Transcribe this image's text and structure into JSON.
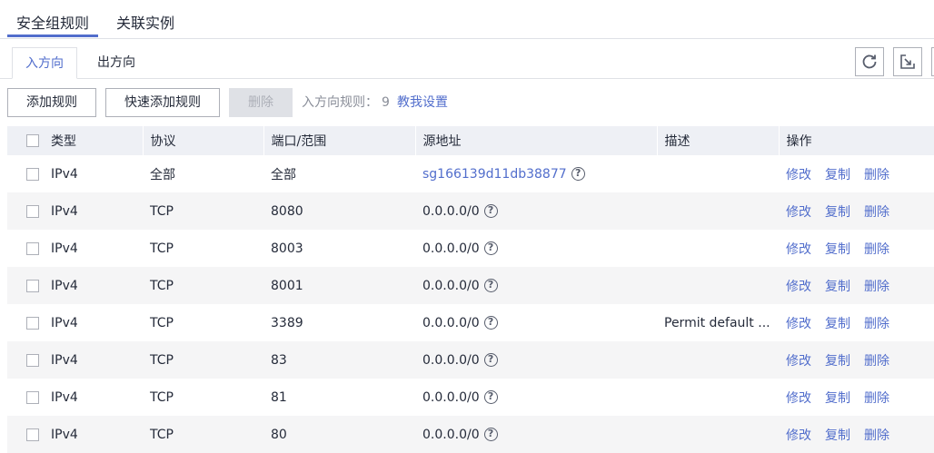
{
  "top_tabs": [
    {
      "label": "安全组规则",
      "active": true
    },
    {
      "label": "关联实例",
      "active": false
    }
  ],
  "sub_tabs": [
    {
      "label": "入方向",
      "active": true
    },
    {
      "label": "出方向",
      "active": false
    }
  ],
  "toolbar": {
    "add_rule": "添加规则",
    "quick_add_rule": "快速添加规则",
    "delete": "删除",
    "rule_count_label": "入方向规则：",
    "rule_count": "9",
    "help_link": "教我设置"
  },
  "icons": {
    "refresh": "refresh-icon",
    "export": "export-icon"
  },
  "table": {
    "headers": [
      "类型",
      "协议",
      "端口/范围",
      "源地址",
      "描述",
      "操作"
    ],
    "rows": [
      {
        "type": "IPv4",
        "protocol": "全部",
        "port": "全部",
        "source": "sg166139d11db38877",
        "source_is_link": true,
        "desc": ""
      },
      {
        "type": "IPv4",
        "protocol": "TCP",
        "port": "8080",
        "source": "0.0.0.0/0",
        "source_is_link": false,
        "desc": ""
      },
      {
        "type": "IPv4",
        "protocol": "TCP",
        "port": "8003",
        "source": "0.0.0.0/0",
        "source_is_link": false,
        "desc": ""
      },
      {
        "type": "IPv4",
        "protocol": "TCP",
        "port": "8001",
        "source": "0.0.0.0/0",
        "source_is_link": false,
        "desc": ""
      },
      {
        "type": "IPv4",
        "protocol": "TCP",
        "port": "3389",
        "source": "0.0.0.0/0",
        "source_is_link": false,
        "desc": "Permit default ..."
      },
      {
        "type": "IPv4",
        "protocol": "TCP",
        "port": "83",
        "source": "0.0.0.0/0",
        "source_is_link": false,
        "desc": ""
      },
      {
        "type": "IPv4",
        "protocol": "TCP",
        "port": "81",
        "source": "0.0.0.0/0",
        "source_is_link": false,
        "desc": ""
      },
      {
        "type": "IPv4",
        "protocol": "TCP",
        "port": "80",
        "source": "0.0.0.0/0",
        "source_is_link": false,
        "desc": ""
      }
    ],
    "actions": {
      "edit": "修改",
      "copy": "复制",
      "delete": "删除"
    }
  },
  "colors": {
    "accent": "#526ecc",
    "header_bg": "#eef0f5",
    "stripe": "#f5f5f6"
  }
}
